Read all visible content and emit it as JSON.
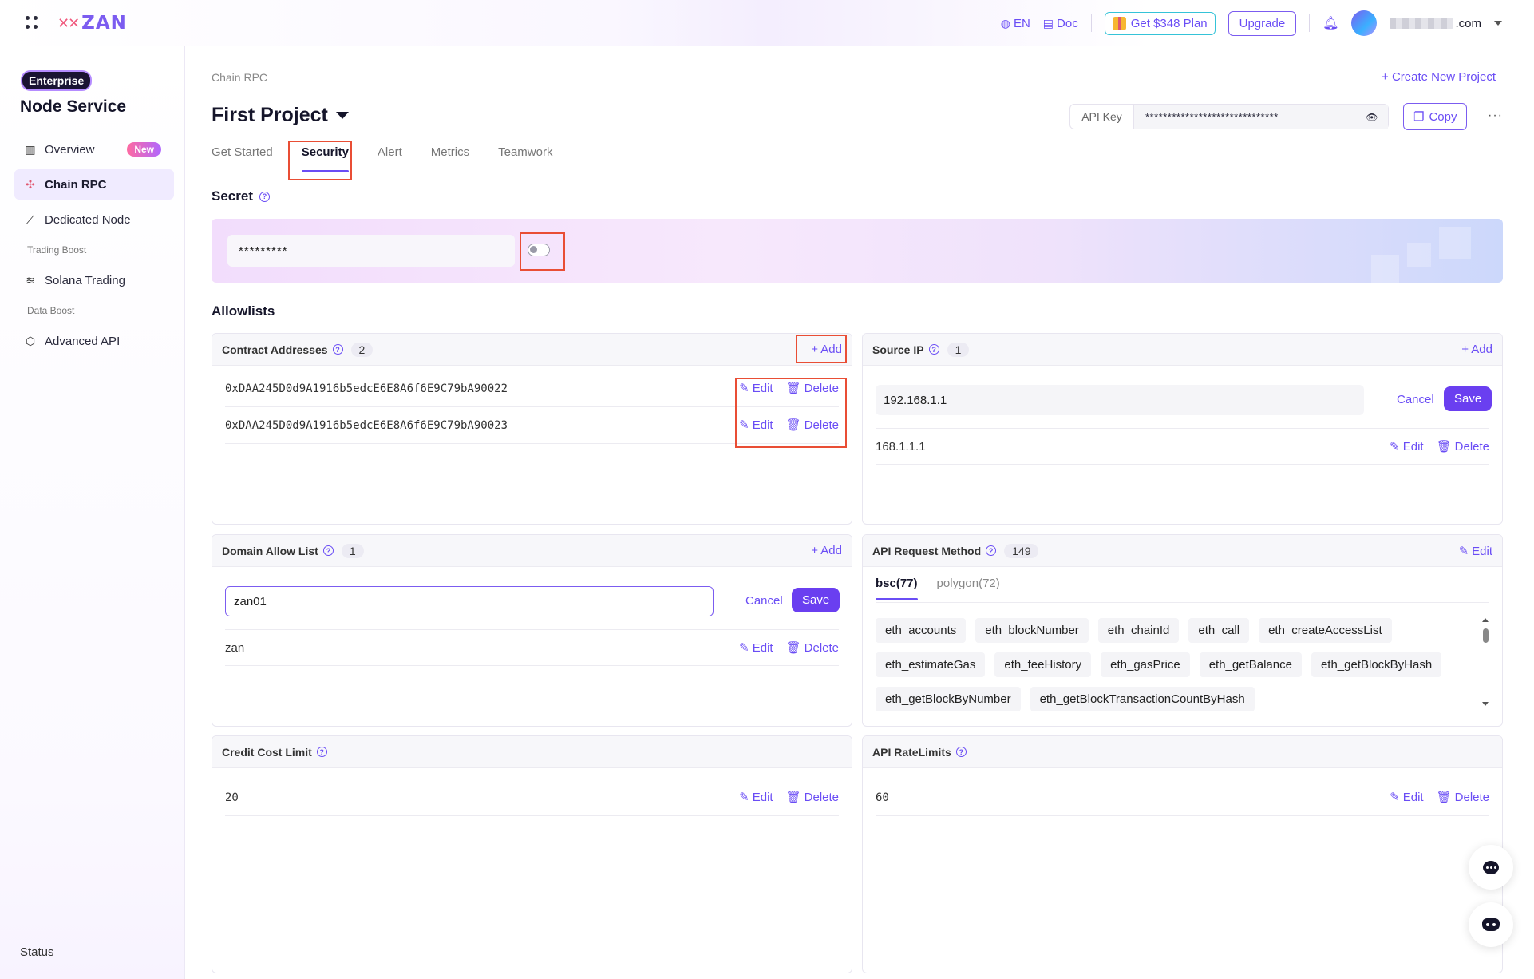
{
  "header": {
    "logo_text": "ZAN",
    "lang": "EN",
    "doc": "Doc",
    "plan": "Get $348 Plan",
    "upgrade": "Upgrade",
    "email_suffix": ".com"
  },
  "sidebar": {
    "badge": "Enterprise",
    "title": "Node Service",
    "items": [
      {
        "label": "Overview",
        "badge": "New"
      },
      {
        "label": "Chain RPC"
      },
      {
        "label": "Dedicated Node"
      },
      {
        "group": "Trading Boost"
      },
      {
        "label": "Solana Trading"
      },
      {
        "group": "Data Boost"
      },
      {
        "label": "Advanced API"
      }
    ],
    "status": "Status"
  },
  "main": {
    "breadcrumb": "Chain RPC",
    "create_project": "+ Create New Project",
    "project_title": "First Project",
    "api_key_label": "API Key",
    "api_key_value": "******************************",
    "copy": "Copy",
    "more": "···",
    "tabs": [
      "Get Started",
      "Security",
      "Alert",
      "Metrics",
      "Teamwork"
    ],
    "active_tab": "Security"
  },
  "secret": {
    "title": "Secret",
    "value": "*********",
    "toggle_on": false
  },
  "allowlists": {
    "title": "Allowlists",
    "add": "+ Add",
    "edit": "Edit",
    "delete": "Delete",
    "cancel": "Cancel",
    "save": "Save",
    "contract": {
      "title": "Contract Addresses",
      "count": "2",
      "rows": [
        "0xDAA245D0d9A1916b5edcE6E8A6f6E9C79bA90022",
        "0xDAA245D0d9A1916b5edcE6E8A6f6E9C79bA90023"
      ]
    },
    "source_ip": {
      "title": "Source IP",
      "count": "1",
      "editing_value": "192.168.1.1",
      "rows": [
        "168.1.1.1"
      ]
    },
    "domain": {
      "title": "Domain Allow List",
      "count": "1",
      "editing_value": "zan01",
      "rows": [
        "zan"
      ]
    },
    "api_method": {
      "title": "API Request Method",
      "count": "149",
      "edit": "Edit",
      "tabs": [
        "bsc(77)",
        "polygon(72)"
      ],
      "chips": [
        "eth_accounts",
        "eth_blockNumber",
        "eth_chainId",
        "eth_call",
        "eth_createAccessList",
        "eth_estimateGas",
        "eth_feeHistory",
        "eth_gasPrice",
        "eth_getBalance",
        "eth_getBlockByHash",
        "eth_getBlockByNumber",
        "eth_getBlockTransactionCountByHash"
      ]
    },
    "credit": {
      "title": "Credit Cost Limit",
      "value": "20"
    },
    "rate": {
      "title": "API RateLimits",
      "value": "60"
    }
  },
  "colors": {
    "accent": "#6a4df5",
    "highlight_box": "#e94e35"
  }
}
